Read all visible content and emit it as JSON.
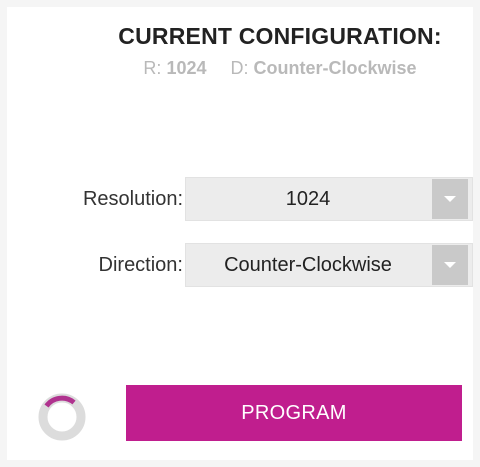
{
  "header": {
    "title": "CURRENT CONFIGURATION:",
    "resolution_label": "R:",
    "resolution_value": "1024",
    "direction_label": "D:",
    "direction_value": "Counter-Clockwise"
  },
  "form": {
    "resolution": {
      "label": "Resolution:",
      "selected": "1024"
    },
    "direction": {
      "label": "Direction:",
      "selected": "Counter-Clockwise"
    }
  },
  "actions": {
    "program_label": "PROGRAM"
  },
  "icons": {
    "dropdown": "chevron-down-icon",
    "spinner": "loading-spinner-icon"
  },
  "colors": {
    "accent": "#c01e8e",
    "spinner_track": "#dcdcdc",
    "spinner_arc": "#b0338f",
    "muted_text": "#b9b9b9",
    "select_bg": "#ececec",
    "arrow_bg": "#c9c9c9"
  }
}
